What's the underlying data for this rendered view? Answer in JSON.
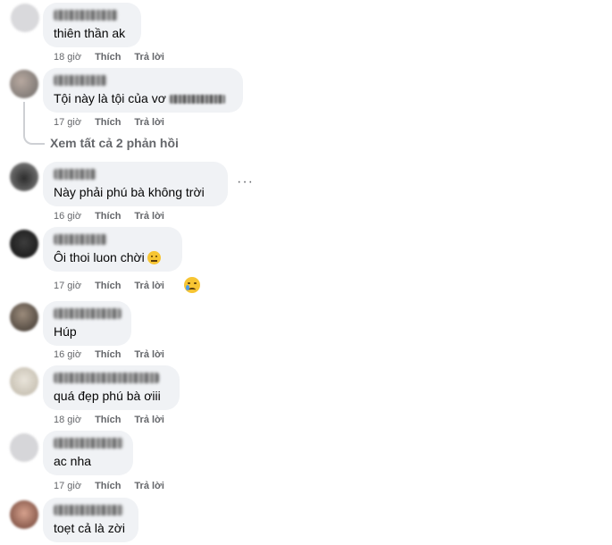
{
  "labels": {
    "like": "Thích",
    "reply": "Trả lời"
  },
  "comments": [
    {
      "time": "18 giờ",
      "text": "thiên thần ak"
    },
    {
      "time": "17 giờ",
      "text": "Tội này là tội của vơ"
    },
    {
      "time": "16 giờ",
      "text": "Này phải phú bà không trời"
    },
    {
      "time": "17 giờ",
      "text": "Ôi thoi luon chời"
    },
    {
      "time": "16 giờ",
      "text": "Húp"
    },
    {
      "time": "18 giờ",
      "text": "quá đẹp phú bà ơiii"
    },
    {
      "time": "17 giờ",
      "text": "ac nha"
    },
    {
      "time": "",
      "text": "toẹt cả là zời"
    }
  ],
  "view_replies": "Xem tất cả 2 phản hồi",
  "more_options": "···",
  "colors": {
    "bubble": "#f0f2f5",
    "meta": "#65676b",
    "text": "#050505"
  },
  "icons": [
    "more-options-icon",
    "neutral-face-emoji-icon",
    "sad-reaction-icon"
  ]
}
